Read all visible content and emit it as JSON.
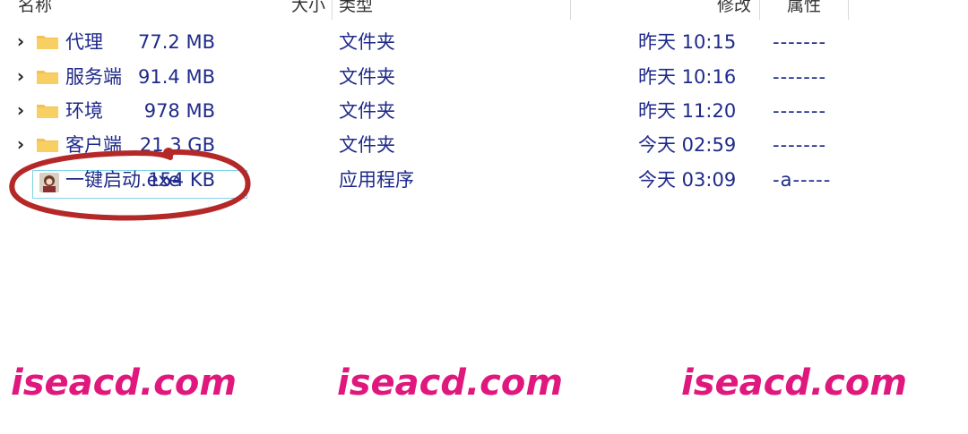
{
  "header": {
    "name": "名称",
    "sort_arrow": "^",
    "size": "大小",
    "type": "类型",
    "modified": "修改",
    "attributes": "属性"
  },
  "files": [
    {
      "name": "代理",
      "size": "77.2 MB",
      "type": "文件夹",
      "date": "昨天 10:15",
      "attr": "-------",
      "kind": "folder"
    },
    {
      "name": "服务端",
      "size": "91.4 MB",
      "type": "文件夹",
      "date": "昨天 10:16",
      "attr": "-------",
      "kind": "folder"
    },
    {
      "name": "环境",
      "size": "978 MB",
      "type": "文件夹",
      "date": "昨天 11:20",
      "attr": "-------",
      "kind": "folder"
    },
    {
      "name": "客户端",
      "size": "21.3 GB",
      "type": "文件夹",
      "date": "今天 02:59",
      "attr": "-------",
      "kind": "folder"
    },
    {
      "name": "一键启动.exe",
      "size": "154 KB",
      "type": "应用程序",
      "date": "今天 03:09",
      "attr": "-a-----",
      "kind": "exe"
    }
  ],
  "watermark": "iseacd.com",
  "colors": {
    "text": "#1f2a8a",
    "folder": "#f2c14e",
    "selection_border": "#7fd3e6",
    "annotation": "#b52828",
    "watermark": "#e0187e"
  }
}
